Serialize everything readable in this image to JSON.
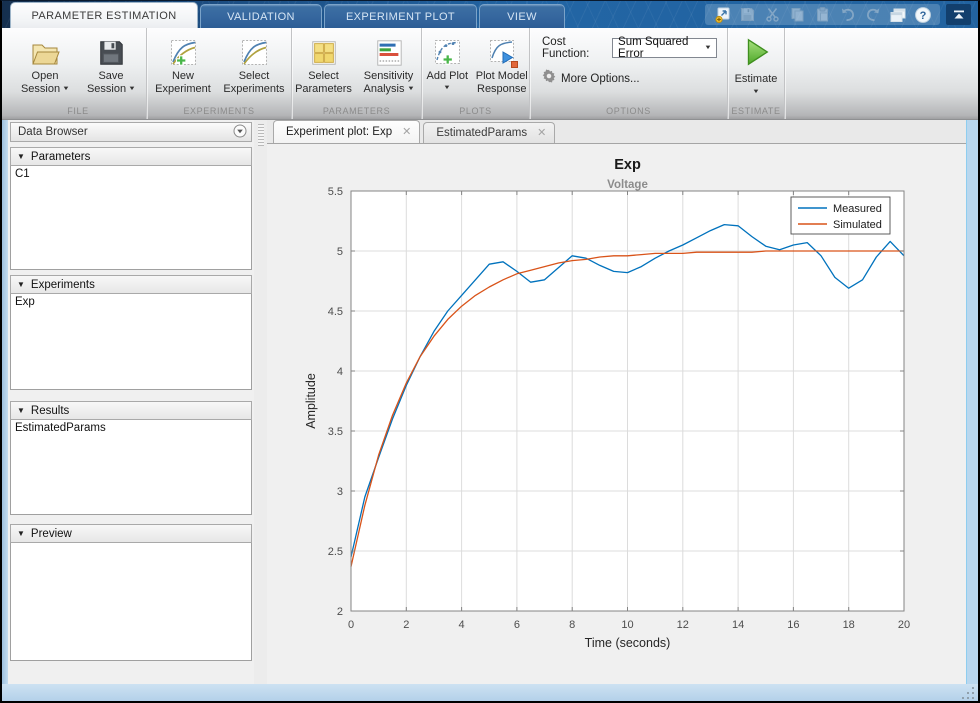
{
  "theme": {
    "titlebar_blue": "#2265a4",
    "frame_blue": "#b9d4ea",
    "estimate_green": "#6fbf3e",
    "measured_blue": "#0072BD",
    "simulated_orange": "#D95319"
  },
  "titlebar": {
    "tabs": [
      {
        "label": "PARAMETER ESTIMATION",
        "active": true
      },
      {
        "label": "VALIDATION",
        "active": false
      },
      {
        "label": "EXPERIMENT PLOT",
        "active": false
      },
      {
        "label": "VIEW",
        "active": false
      }
    ],
    "quick_access_icons": [
      "new-session",
      "save",
      "cut",
      "copy",
      "paste",
      "undo",
      "redo",
      "window-layout",
      "help",
      "collapse-ribbon"
    ]
  },
  "ribbon": {
    "file": {
      "label": "FILE",
      "open": {
        "line1": "Open",
        "line2": "Session"
      },
      "save": {
        "line1": "Save",
        "line2": "Session"
      }
    },
    "experiments": {
      "label": "EXPERIMENTS",
      "new": {
        "line1": "New",
        "line2": "Experiment"
      },
      "select": {
        "line1": "Select",
        "line2": "Experiments"
      }
    },
    "parameters": {
      "label": "PARAMETERS",
      "select": {
        "line1": "Select",
        "line2": "Parameters"
      },
      "sensitivity": {
        "line1": "Sensitivity",
        "line2": "Analysis"
      }
    },
    "plots": {
      "label": "PLOTS",
      "add": {
        "line1": "Add Plot"
      },
      "response": {
        "line1": "Plot Model",
        "line2": "Response"
      }
    },
    "options": {
      "label": "OPTIONS",
      "cost_function_label": "Cost Function:",
      "cost_function_value": "Sum Squared Error",
      "more_options": "More Options..."
    },
    "estimate": {
      "label": "ESTIMATE",
      "button": "Estimate"
    }
  },
  "sidebar": {
    "title": "Data Browser",
    "sections": [
      {
        "label": "Parameters",
        "items": [
          "C1"
        ]
      },
      {
        "label": "Experiments",
        "items": [
          "Exp"
        ]
      },
      {
        "label": "Results",
        "items": [
          "EstimatedParams"
        ]
      },
      {
        "label": "Preview",
        "items": []
      }
    ]
  },
  "document": {
    "tabs": [
      {
        "label": "Experiment plot: Exp",
        "active": true
      },
      {
        "label": "EstimatedParams",
        "active": false
      }
    ]
  },
  "chart_data": {
    "type": "line",
    "title": "Exp",
    "subtitle": "Voltage",
    "xlabel": "Time (seconds)",
    "ylabel": "Amplitude",
    "xlim": [
      0,
      20
    ],
    "ylim": [
      2,
      5.5
    ],
    "xticks": [
      0,
      2,
      4,
      6,
      8,
      10,
      12,
      14,
      16,
      18,
      20
    ],
    "yticks": [
      2,
      2.5,
      3,
      3.5,
      4,
      4.5,
      5,
      5.5
    ],
    "grid": true,
    "legend_position": "northeast",
    "series": [
      {
        "name": "Measured",
        "color": "#0072BD",
        "points": [
          [
            0,
            2.45
          ],
          [
            0.5,
            2.95
          ],
          [
            1,
            3.28
          ],
          [
            1.5,
            3.6
          ],
          [
            2,
            3.88
          ],
          [
            2.5,
            4.12
          ],
          [
            3,
            4.33
          ],
          [
            3.5,
            4.5
          ],
          [
            4,
            4.63
          ],
          [
            4.5,
            4.76
          ],
          [
            5,
            4.89
          ],
          [
            5.5,
            4.91
          ],
          [
            6,
            4.83
          ],
          [
            6.5,
            4.74
          ],
          [
            7,
            4.76
          ],
          [
            7.5,
            4.86
          ],
          [
            8,
            4.96
          ],
          [
            8.5,
            4.94
          ],
          [
            9,
            4.88
          ],
          [
            9.5,
            4.83
          ],
          [
            10,
            4.82
          ],
          [
            10.5,
            4.87
          ],
          [
            11,
            4.94
          ],
          [
            11.5,
            5.0
          ],
          [
            12,
            5.05
          ],
          [
            12.5,
            5.11
          ],
          [
            13,
            5.17
          ],
          [
            13.5,
            5.22
          ],
          [
            14,
            5.21
          ],
          [
            14.5,
            5.12
          ],
          [
            15,
            5.04
          ],
          [
            15.5,
            5.01
          ],
          [
            16,
            5.05
          ],
          [
            16.5,
            5.07
          ],
          [
            17,
            4.96
          ],
          [
            17.5,
            4.78
          ],
          [
            18,
            4.69
          ],
          [
            18.5,
            4.76
          ],
          [
            19,
            4.95
          ],
          [
            19.5,
            5.08
          ],
          [
            20,
            4.96
          ]
        ]
      },
      {
        "name": "Simulated",
        "color": "#D95319",
        "points": [
          [
            0,
            2.37
          ],
          [
            0.5,
            2.88
          ],
          [
            1,
            3.3
          ],
          [
            1.5,
            3.63
          ],
          [
            2,
            3.9
          ],
          [
            2.5,
            4.12
          ],
          [
            3,
            4.29
          ],
          [
            3.5,
            4.43
          ],
          [
            4,
            4.54
          ],
          [
            4.5,
            4.63
          ],
          [
            5,
            4.7
          ],
          [
            5.5,
            4.76
          ],
          [
            6,
            4.81
          ],
          [
            6.5,
            4.84
          ],
          [
            7,
            4.87
          ],
          [
            7.5,
            4.9
          ],
          [
            8,
            4.92
          ],
          [
            8.5,
            4.93
          ],
          [
            9,
            4.95
          ],
          [
            9.5,
            4.96
          ],
          [
            10,
            4.96
          ],
          [
            10.5,
            4.97
          ],
          [
            11,
            4.98
          ],
          [
            11.5,
            4.98
          ],
          [
            12,
            4.98
          ],
          [
            12.5,
            4.99
          ],
          [
            13,
            4.99
          ],
          [
            13.5,
            4.99
          ],
          [
            14,
            4.99
          ],
          [
            14.5,
            4.99
          ],
          [
            15,
            5.0
          ],
          [
            15.5,
            5.0
          ],
          [
            16,
            5.0
          ],
          [
            16.5,
            5.0
          ],
          [
            17,
            5.0
          ],
          [
            17.5,
            5.0
          ],
          [
            18,
            5.0
          ],
          [
            18.5,
            5.0
          ],
          [
            19,
            5.0
          ],
          [
            19.5,
            5.0
          ],
          [
            20,
            5.0
          ]
        ]
      }
    ]
  }
}
